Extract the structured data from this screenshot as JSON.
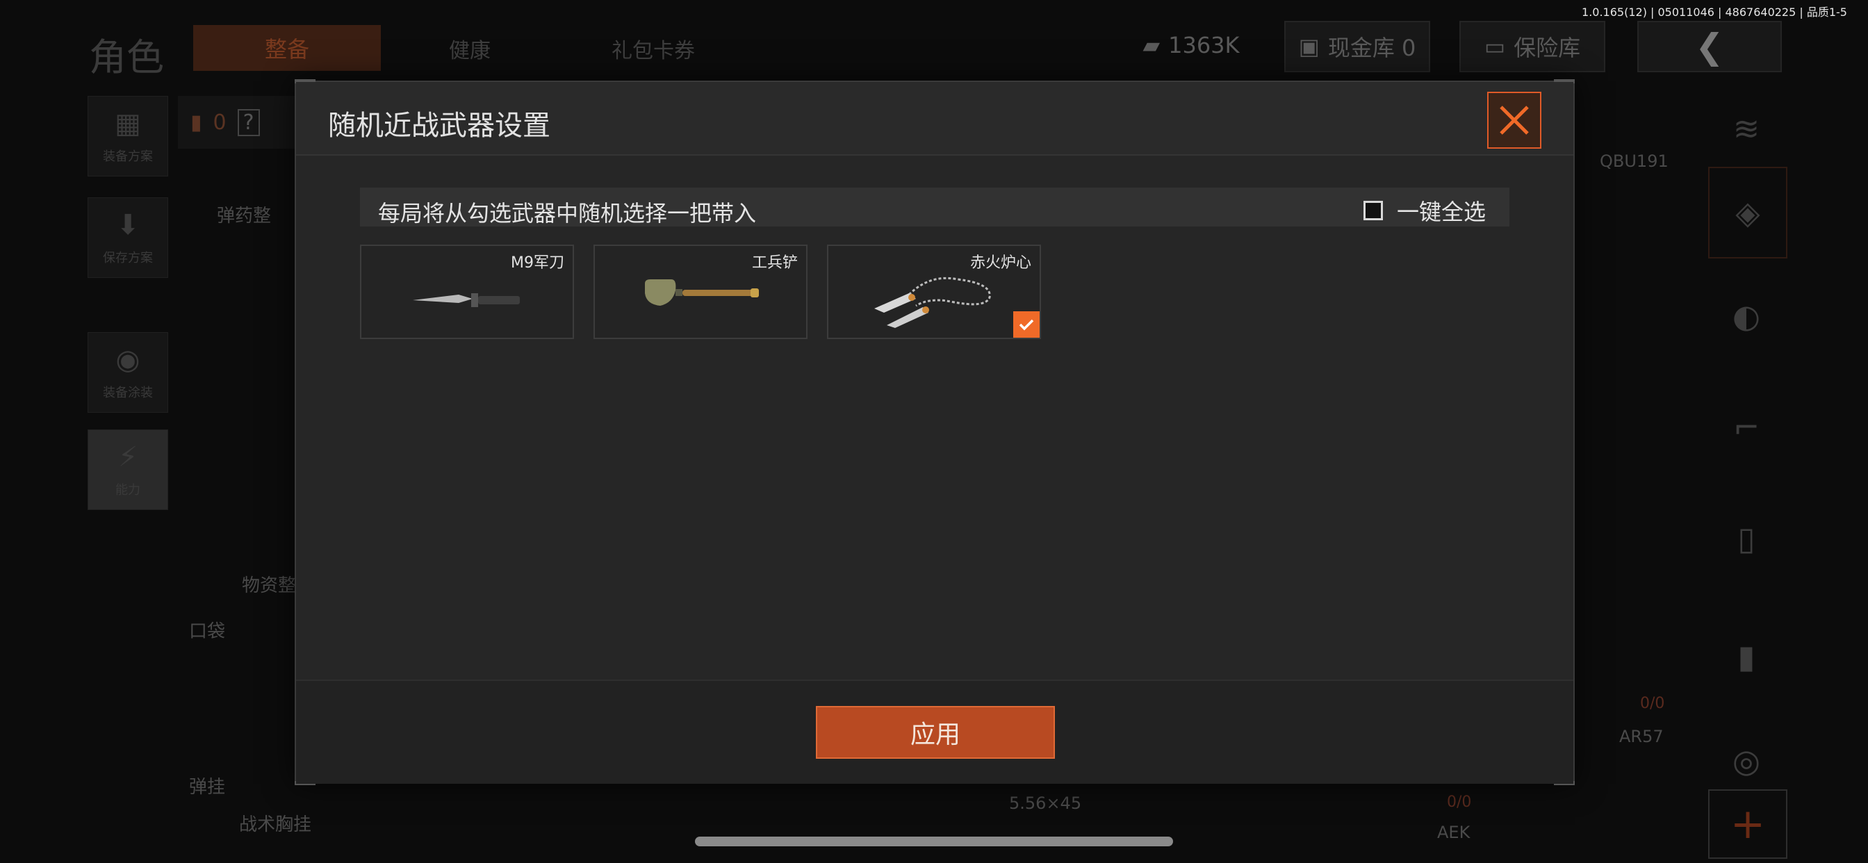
{
  "version": "1.0.165(12) | 05011046 | 4867640225 | 品质1-5",
  "background": {
    "title": "角色",
    "tabs": [
      "整备",
      "健康",
      "礼包卡券"
    ],
    "currency": "1363K",
    "cash_vault": "现金库 0",
    "safe_box": "保险库",
    "side": [
      "装备方案",
      "保存方案",
      "装备涂装",
      "能力"
    ],
    "labels": {
      "ammo_sort": "弹药整",
      "supply_sort": "物资整",
      "pocket": "口袋",
      "hanger": "弹挂",
      "tactical_vest": "战术胸挂",
      "count_zero": "0",
      "help": "?",
      "weapon_right": "QBU191",
      "ammo_ratio_1": "0/0",
      "weapon_ar": "AR57",
      "caliber": "5.56×45",
      "ammo_ratio_2": "0/0",
      "weapon_aek": "AEK"
    }
  },
  "modal": {
    "title": "随机近战武器设置",
    "info_text": "每局将从勾选武器中随机选择一把带入",
    "select_all_label": "一键全选",
    "select_all_checked": false,
    "weapons": [
      {
        "name": "M9军刀",
        "icon": "knife-icon",
        "checked": false
      },
      {
        "name": "工兵铲",
        "icon": "shovel-icon",
        "checked": false
      },
      {
        "name": "赤火炉心",
        "icon": "chain-blades-icon",
        "checked": true
      }
    ],
    "apply_label": "应用"
  },
  "colors": {
    "accent": "#f06a28",
    "button": "#b84a22"
  }
}
